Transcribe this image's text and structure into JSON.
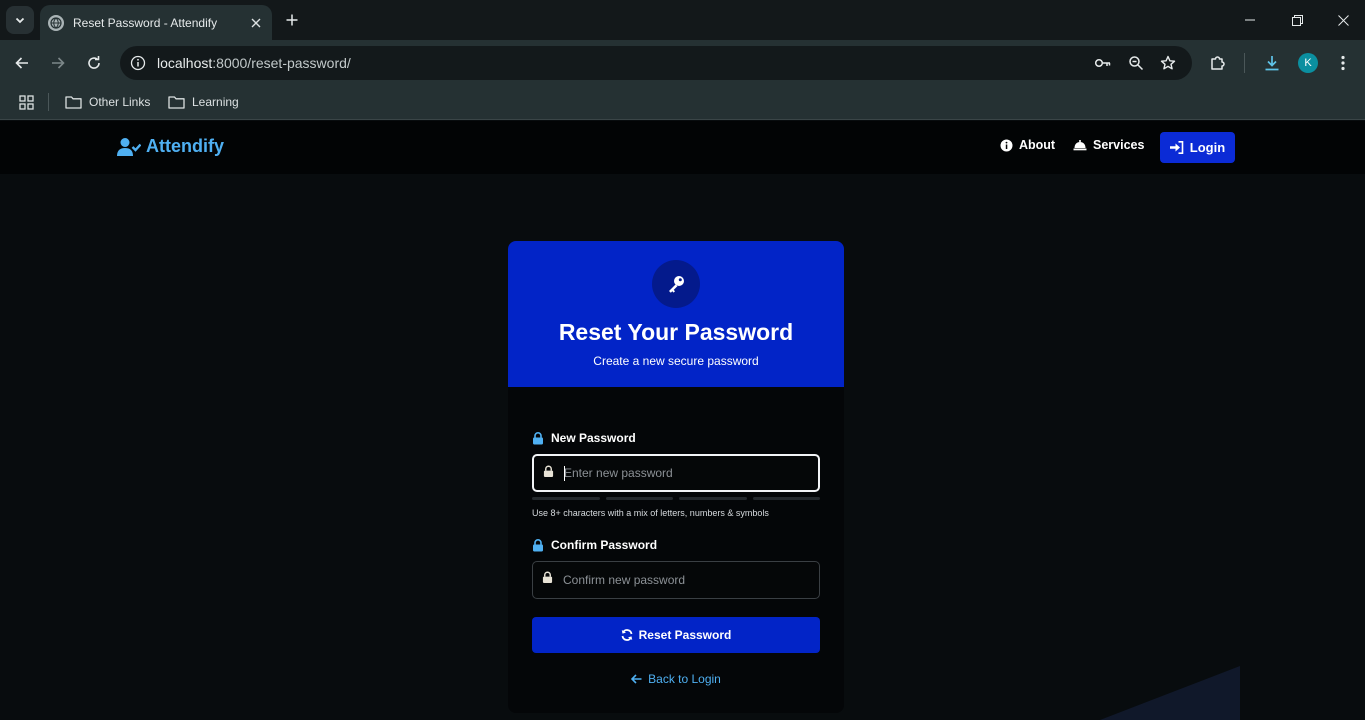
{
  "browser": {
    "tab_title": "Reset Password - Attendify",
    "url_host": "localhost",
    "url_path": ":8000/reset-password/",
    "profile_initial": "K",
    "bookmarks": [
      "Other Links",
      "Learning"
    ]
  },
  "nav": {
    "brand": "Attendify",
    "links": [
      "About",
      "Services"
    ],
    "login_label": "Login"
  },
  "card": {
    "title": "Reset Your Password",
    "subtitle": "Create a new secure password",
    "new_password_label": "New Password",
    "new_password_placeholder": "Enter new password",
    "new_password_value": "",
    "hint": "Use 8+ characters with a mix of letters, numbers & symbols",
    "confirm_password_label": "Confirm Password",
    "confirm_password_placeholder": "Confirm new password",
    "confirm_password_value": "",
    "submit_label": "Reset Password",
    "back_label": "Back to Login"
  },
  "colors": {
    "brand_blue": "#0224c7",
    "accent_light_blue": "#4fb0f2",
    "page_bg": "#080c0e"
  }
}
